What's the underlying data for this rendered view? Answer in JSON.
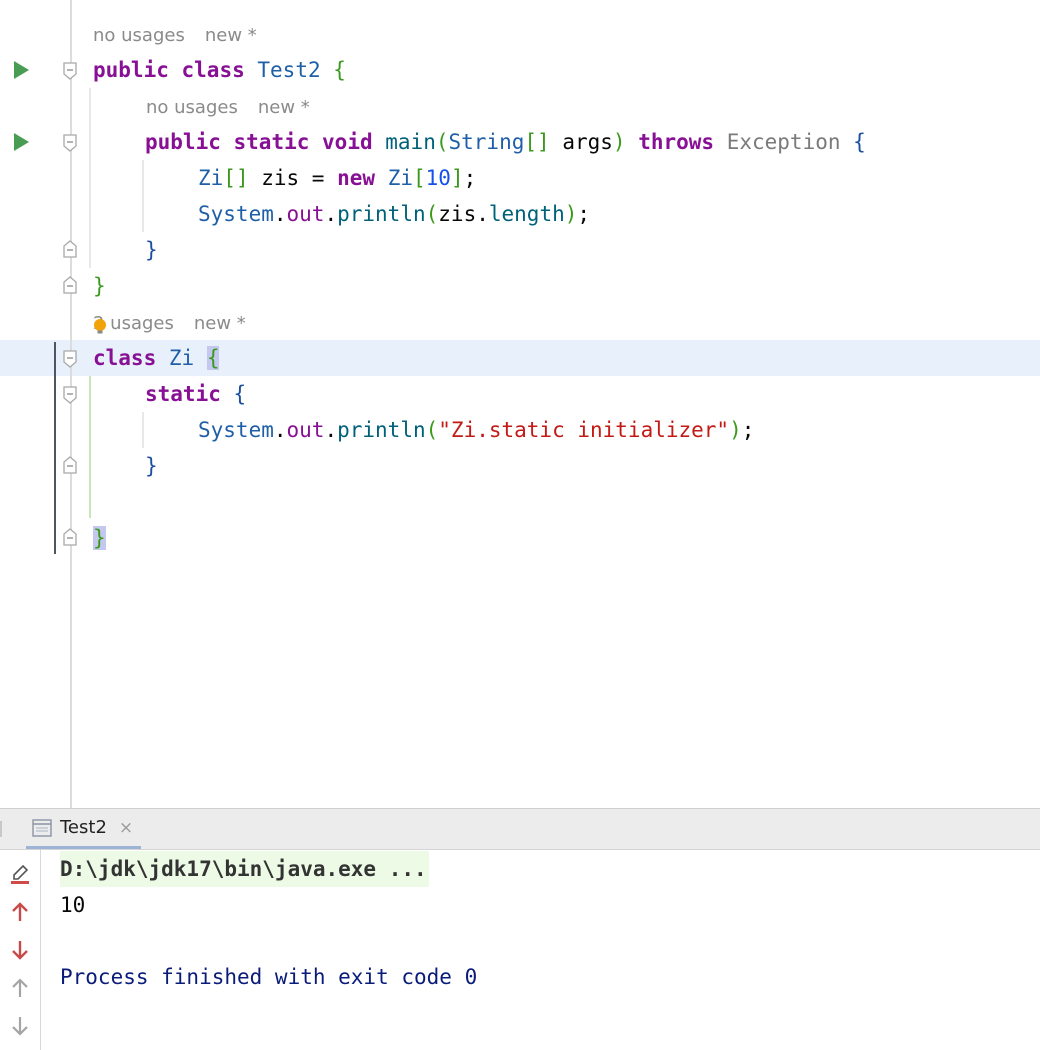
{
  "editor": {
    "hints": [
      {
        "usages": "no usages",
        "status": "new *"
      },
      {
        "usages": "no usages",
        "status": "new *"
      },
      {
        "usages": "2 usages",
        "status": "new *"
      }
    ],
    "lines": {
      "l1": {
        "kw1": "public",
        "kw2": "class",
        "name": "Test2",
        "brace": "{"
      },
      "l2": {
        "kw1": "public",
        "kw2": "static",
        "kw3": "void",
        "fn": "main",
        "p_open": "(",
        "type": "String",
        "arr": "[]",
        "arg": "args",
        "p_close": ")",
        "throws": "throws",
        "exc": "Exception",
        "brace": "{"
      },
      "l3": {
        "type": "Zi",
        "arr": "[]",
        "var": " zis = ",
        "new_kw": "new",
        "type2": "Zi",
        "b_open": "[",
        "num": "10",
        "b_close": "]",
        "semi": ";"
      },
      "l4": {
        "sys": "System",
        "dot1": ".",
        "out": "out",
        "dot2": ".",
        "fn": "println",
        "p_open": "(",
        "arg": "zis",
        "dot3": ".",
        "field": "length",
        "p_close": ")",
        "semi": ";"
      },
      "l5": {
        "brace": "}"
      },
      "l6": {
        "brace": "}"
      },
      "l7": {
        "kw": "class",
        "name": "Zi",
        "brace": "{"
      },
      "l8": {
        "kw": "static",
        "brace": "{"
      },
      "l9": {
        "sys": "System",
        "dot1": ".",
        "out": "out",
        "dot2": ".",
        "fn": "println",
        "p_open": "(",
        "str": "\"Zi.static initializer\"",
        "p_close": ")",
        "semi": ";"
      },
      "l10": {
        "brace": "}"
      },
      "l11": {
        "brace": "}"
      }
    },
    "icons": {
      "run": "run-arrow-icon",
      "fold": "fold-marker-icon",
      "bulb": "intention-bulb-icon"
    },
    "colors": {
      "keyword": "#871094",
      "class": "#0033b3",
      "string": "#c41a16",
      "number": "#1750eb",
      "current_line": "#e8f0fc"
    }
  },
  "run_panel": {
    "tab_label": "Test2",
    "tab_close": "×",
    "output": {
      "command": "D:\\jdk\\jdk17\\bin\\java.exe ...",
      "value": "10",
      "finished": "Process finished with exit code 0"
    },
    "tools": [
      "clear-output-icon",
      "scroll-up-icon",
      "scroll-down-icon",
      "up-arrow-icon",
      "down-arrow-icon"
    ]
  }
}
